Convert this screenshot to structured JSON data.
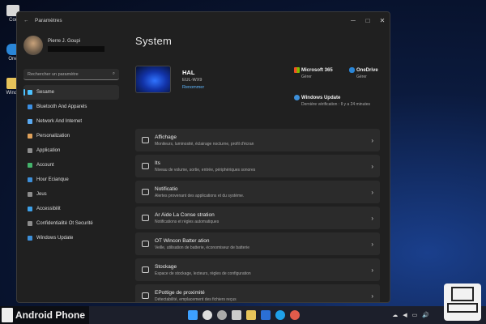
{
  "colors": {
    "accent": "#4cc2ff",
    "window_bg": "#202020",
    "card_bg": "#2b2b2b"
  },
  "desktop": {
    "icons": [
      {
        "label": "Cor",
        "icon": "recycle-bin-icon"
      },
      {
        "label": "One",
        "icon": "onedrive-icon"
      },
      {
        "label": "Windo",
        "icon": "folder-icon"
      }
    ]
  },
  "window": {
    "title": "Paramètres",
    "back_icon": "←",
    "minimize": "─",
    "maximize": "□",
    "close": "✕"
  },
  "profile": {
    "name": "Pierre J. Goupi"
  },
  "search": {
    "placeholder": "Rechercher un paramètre",
    "icon": "⌕"
  },
  "nav": [
    {
      "label": "Sesame",
      "active": true,
      "color": "#4cc2ff"
    },
    {
      "label": "Bluetooth And Apparels",
      "color": "#3b8fe3"
    },
    {
      "label": "Network And Internet",
      "color": "#5aa9f0"
    },
    {
      "label": "Personalization",
      "color": "#e0a15a"
    },
    {
      "label": "Application",
      "color": "#8d8d8d"
    },
    {
      "label": "Account",
      "color": "#44b36b"
    },
    {
      "label": "Hour Ecianque",
      "color": "#3d8fd9"
    },
    {
      "label": "Jeus",
      "color": "#8d8d8d"
    },
    {
      "label": "Accessibilit",
      "color": "#3da0e8"
    },
    {
      "label": "Confidentialité Ot Securité",
      "color": "#8d8d8d"
    },
    {
      "label": "Windows Update",
      "color": "#3d8fd9"
    }
  ],
  "main": {
    "title": "System",
    "device": {
      "name": "HAL",
      "model": "EUL-WX9",
      "rename_link": "Renommer"
    },
    "quick": {
      "m365": {
        "title": "Microsoft 365",
        "sub": "Gérer"
      },
      "onedrive": {
        "title": "OneDrive",
        "sub": "Gérer"
      },
      "update": {
        "title": "Windows Update",
        "sub": "Dernière vérification : Il y a 24 minutes"
      }
    },
    "cards": [
      {
        "title": "Affichage",
        "sub": "Moniteurs, luminosité, éclairage nocturne, profil d'écran"
      },
      {
        "title": "Its",
        "sub": "Niveau de volume, sortie, entrée, périphériques sonores"
      },
      {
        "title": "Notificatio",
        "sub": "Alertes provenant des applications et du système."
      },
      {
        "title": "Ar    Aide La Conse    stration",
        "sub": "Notifications et règles automatiques"
      },
      {
        "title": "OT Wincon Batter    ation",
        "sub": "Veille, utilisation de batterie, économiseur de batterie"
      },
      {
        "title": "Stockage",
        "sub": "Espace de stockage, lecteurs, règles de configuration"
      },
      {
        "title": "EPottige    de proximité",
        "sub": "Détectabilité, emplacement des fichiers reçus"
      }
    ],
    "chevron": "›"
  },
  "taskbar": {
    "icons": [
      "start-icon",
      "search-icon",
      "settings-icon",
      "files-icon",
      "explorer-icon",
      "word-icon",
      "skype-icon",
      "chrome-icon"
    ],
    "colors": [
      "#3da0ff",
      "#dddddd",
      "#aaaaaa",
      "#cccccc",
      "#e6c35a",
      "#2b6fd6",
      "#1fa0e8",
      "#e25b4b"
    ],
    "tray": [
      "☁",
      "◀",
      "▭",
      "🔊"
    ]
  },
  "watermark": {
    "left_text": "Android Phone"
  }
}
